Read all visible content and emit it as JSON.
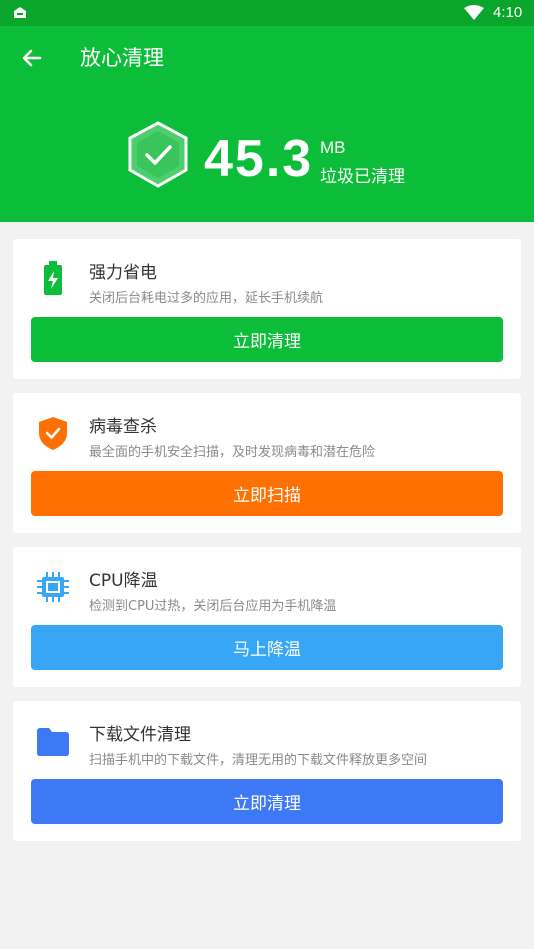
{
  "status_bar": {
    "time": "4:10"
  },
  "header": {
    "title": "放心清理",
    "amount": "45.3",
    "unit": "MB",
    "cleaned_label": "垃圾已清理"
  },
  "cards": [
    {
      "title": "强力省电",
      "desc": "关闭后台耗电过多的应用，延长手机续航",
      "button": "立即清理",
      "icon": "battery-charging-icon",
      "color": "#0bbd38"
    },
    {
      "title": "病毒查杀",
      "desc": "最全面的手机安全扫描，及时发现病毒和潜在危险",
      "button": "立即扫描",
      "icon": "shield-check-icon",
      "color": "#ff7003"
    },
    {
      "title": "CPU降温",
      "desc": "检测到CPU过热，关闭后台应用为手机降温",
      "button": "马上降温",
      "icon": "cpu-chip-icon",
      "color": "#36a6f5"
    },
    {
      "title": "下载文件清理",
      "desc": "扫描手机中的下载文件，清理无用的下载文件释放更多空间",
      "button": "立即清理",
      "icon": "folder-icon",
      "color": "#3d79f5"
    }
  ],
  "colors": {
    "brand_green": "#0bbd38",
    "status_bar": "#0aa62c",
    "background": "#f2f2f2"
  }
}
